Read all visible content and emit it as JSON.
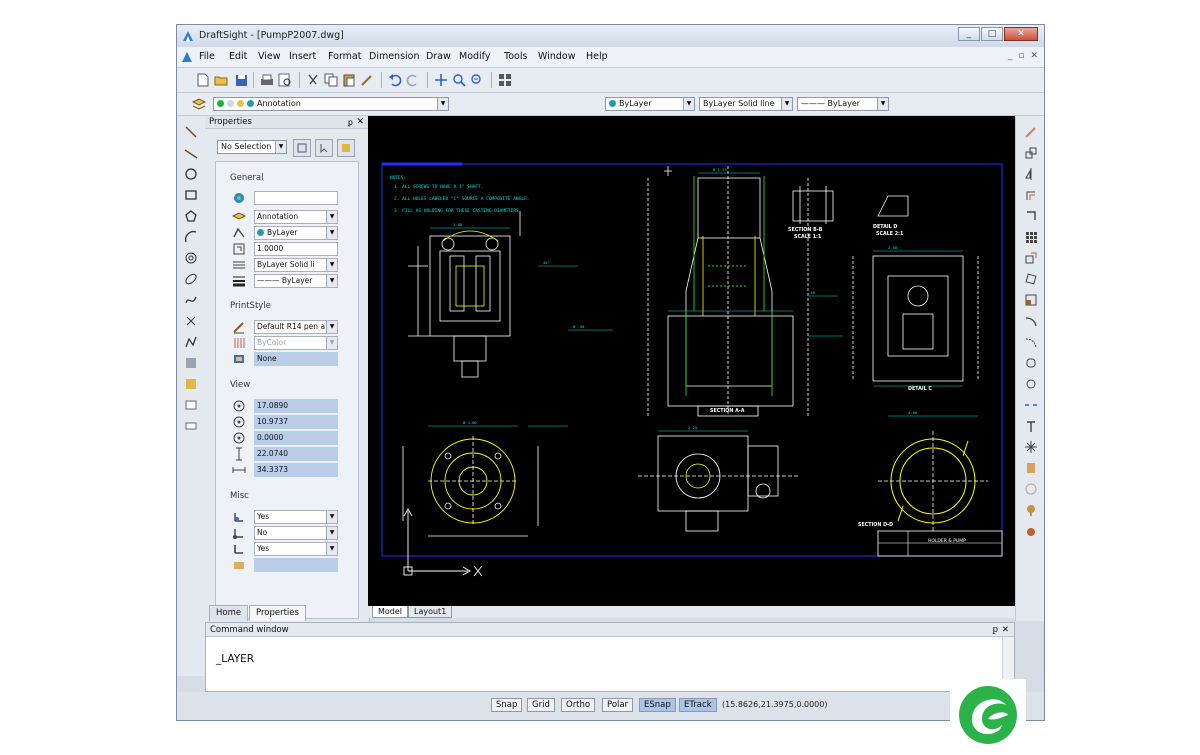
{
  "window": {
    "title": "DraftSight - [PumpP2007.dwg]",
    "buttons": [
      "_",
      "□",
      "✕"
    ]
  },
  "menu": [
    "File",
    "Edit",
    "View",
    "Insert",
    "Format",
    "Dimension",
    "Draw",
    "Modify",
    "Tools",
    "Window",
    "Help"
  ],
  "mdi_controls": [
    "_",
    "▫",
    "✕"
  ],
  "layer_combo": {
    "value": "Annotation"
  },
  "color_combo": {
    "value": "ByLayer"
  },
  "linestyle_combo": {
    "value": "ByLayer    Solid line"
  },
  "lineweight_combo": {
    "value": "——— ByLayer"
  },
  "properties": {
    "title": "Properties",
    "pin": "ꝑ",
    "close": "✕",
    "selection": "No Selection",
    "sections": {
      "general": "General",
      "printstyle": "PrintStyle",
      "view": "View",
      "misc": "Misc"
    },
    "general": [
      "",
      "Annotation",
      "ByLayer",
      "1.0000",
      "ByLayer    Solid li",
      "——— ByLayer"
    ],
    "printstyle": [
      "Default R14 pen a",
      "ByColor",
      "None"
    ],
    "view": [
      "17.0890",
      "10.9737",
      "0.0000",
      "22.0740",
      "34.3373"
    ],
    "misc": [
      "Yes",
      "No",
      "Yes",
      ""
    ]
  },
  "panel_tabs": [
    "Home",
    "Properties"
  ],
  "sheet_tabs": [
    "Model",
    "Layout1"
  ],
  "command_window": {
    "title": "Command window",
    "text": "_LAYER"
  },
  "status": {
    "buttons": [
      {
        "label": "Snap",
        "on": false
      },
      {
        "label": "Grid",
        "on": false
      },
      {
        "label": "Ortho",
        "on": false
      },
      {
        "label": "Polar",
        "on": false
      },
      {
        "label": "ESnap",
        "on": true
      },
      {
        "label": "ETrack",
        "on": true
      }
    ],
    "coordinates": "(15.8626,21.3975,0.0000)"
  },
  "drawing": {
    "notes": [
      "NOTES:",
      "1. ALL SCREWS TO HAVE A 1\" SHAFT.",
      "2. ALL HOLES LABELED \"C\" SOURCE A COMPOSITE ANGLE.",
      "3. FILL AS HOLDING FOR THESE CASTING DIAMETERS."
    ],
    "labels": [
      "SECTION B-B",
      "SCALE 1:1",
      "DETAIL D",
      "SCALE 2:1",
      "SECTION A-A",
      "DETAIL C",
      "SECTION D-D",
      "HOLDER & PUMP"
    ],
    "colors": {
      "background": "#000000",
      "lines": "#ffffff",
      "dimensions": "#00e0e0",
      "section": "#ffff00",
      "hatch": "#22dd22",
      "frame": "#2a2aff"
    }
  },
  "brand": {
    "color": "#2bb34a"
  }
}
